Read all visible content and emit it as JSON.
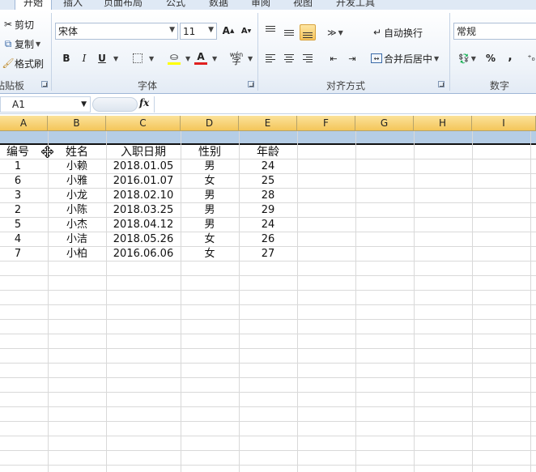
{
  "tabs": [
    "开始",
    "插入",
    "页面布局",
    "公式",
    "数据",
    "审阅",
    "视图",
    "开发工具"
  ],
  "clipboard": {
    "cut": "剪切",
    "copy": "复制",
    "format_painter": "格式刷",
    "label": "粘贴板"
  },
  "font": {
    "name": "宋体",
    "size": "11",
    "bold": "B",
    "italic": "I",
    "underline": "U",
    "grow": "A",
    "shrink": "A",
    "font_color": "A",
    "pinyin": "wén",
    "label": "字体"
  },
  "alignment": {
    "wrap_text": "自动换行",
    "merge_center": "合并后居中",
    "label": "对齐方式"
  },
  "number": {
    "format": "常规",
    "percent": "%",
    "comma": ",",
    "label": "数字"
  },
  "formula_bar": {
    "name_box": "A1",
    "fx": "fx",
    "value": ""
  },
  "columns": [
    "A",
    "B",
    "C",
    "D",
    "E",
    "F",
    "G",
    "H",
    "I"
  ],
  "table": {
    "headers": [
      "编号",
      "姓名",
      "入职日期",
      "性别",
      "年龄"
    ],
    "rows": [
      [
        "1",
        "小赖",
        "2018.01.05",
        "男",
        "24"
      ],
      [
        "6",
        "小雅",
        "2016.01.07",
        "女",
        "25"
      ],
      [
        "3",
        "小龙",
        "2018.02.10",
        "男",
        "28"
      ],
      [
        "2",
        "小陈",
        "2018.03.25",
        "男",
        "29"
      ],
      [
        "5",
        "小杰",
        "2018.04.12",
        "男",
        "24"
      ],
      [
        "4",
        "小洁",
        "2018.05.26",
        "女",
        "26"
      ],
      [
        "7",
        "小柏",
        "2016.06.06",
        "女",
        "27"
      ]
    ]
  },
  "colors": {
    "header_fill": "#f4c65a",
    "selection": "#b5cde6",
    "grid": "#d9d9d9",
    "font_color_bar": "#e02020",
    "highlight_bar": "#ffff00"
  }
}
